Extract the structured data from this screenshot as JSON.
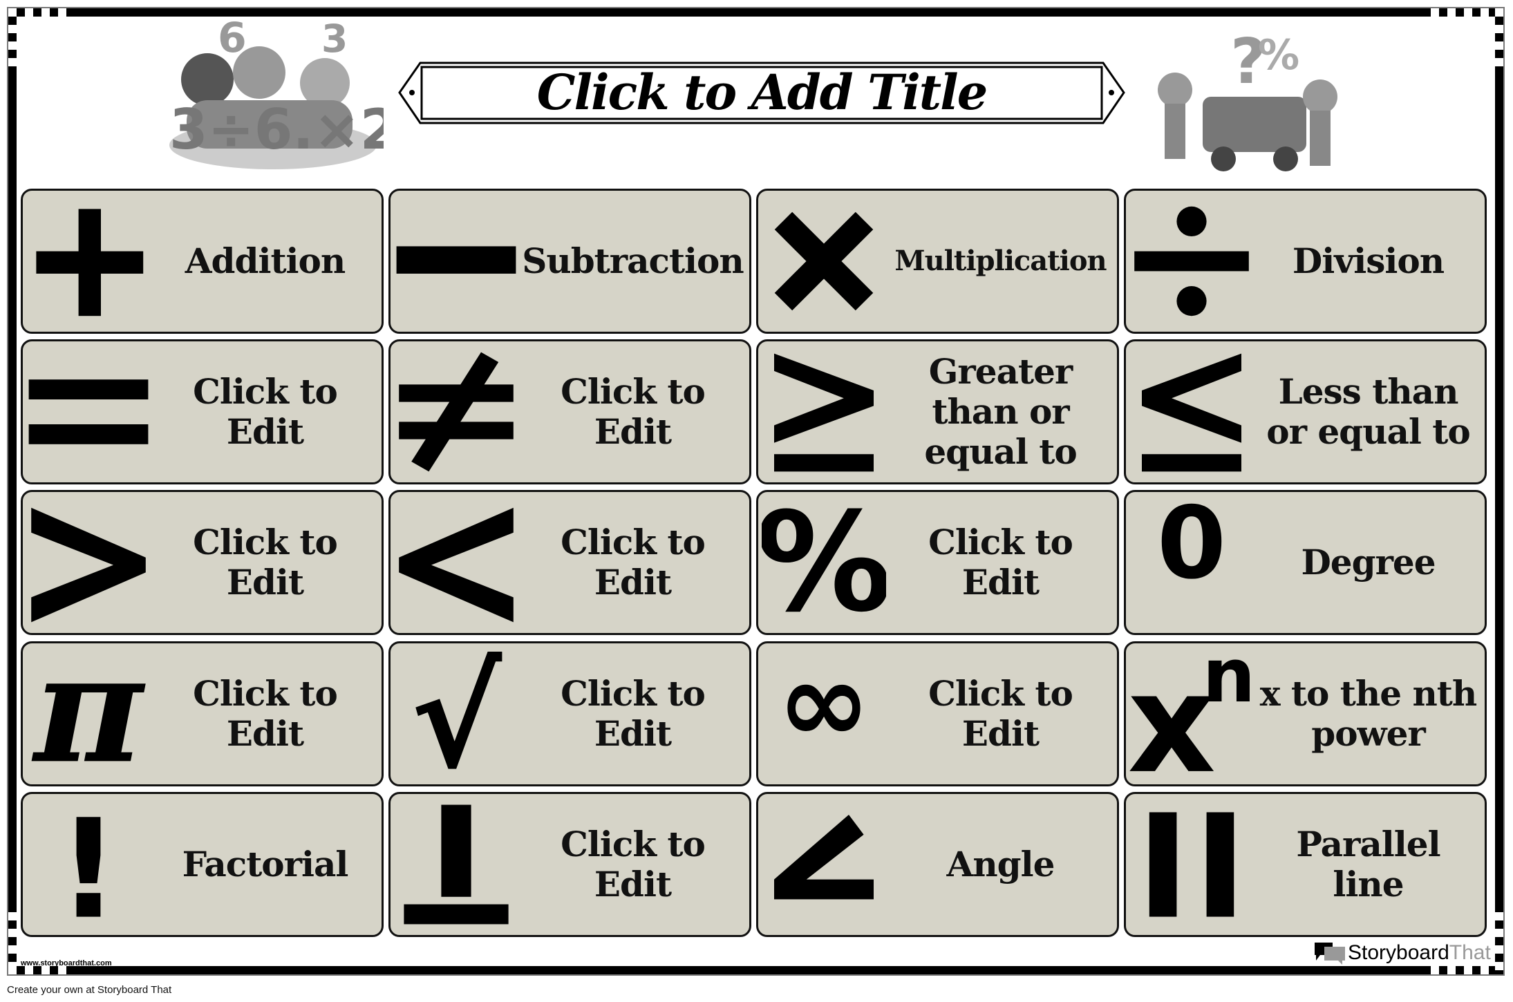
{
  "title": "Click to Add Title",
  "colors": {
    "card_bg": "#d6d4c8",
    "border": "#000000",
    "brand_gray": "#999999"
  },
  "cards": [
    {
      "symbol": "plus-icon",
      "label": "Addition"
    },
    {
      "symbol": "minus-icon",
      "label": "Subtraction"
    },
    {
      "symbol": "times-icon",
      "label": "Multiplication",
      "small": true
    },
    {
      "symbol": "divide-icon",
      "label": "Division"
    },
    {
      "symbol": "equals-icon",
      "label": "Click to Edit"
    },
    {
      "symbol": "not-equal-icon",
      "label": "Click to Edit"
    },
    {
      "symbol": "greater-equal-icon",
      "label": "Greater than or equal to"
    },
    {
      "symbol": "less-equal-icon",
      "label": "Less than or equal to"
    },
    {
      "symbol": "greater-than-icon",
      "label": "Click to Edit"
    },
    {
      "symbol": "less-than-icon",
      "label": "Click to Edit"
    },
    {
      "symbol": "percent-icon",
      "label": "Click to Edit"
    },
    {
      "symbol": "degree-icon",
      "label": "Degree"
    },
    {
      "symbol": "pi-icon",
      "label": "Click to Edit"
    },
    {
      "symbol": "square-root-icon",
      "label": "Click to Edit"
    },
    {
      "symbol": "infinity-icon",
      "label": "Click to Edit"
    },
    {
      "symbol": "exponent-icon",
      "label": "x to the nth power"
    },
    {
      "symbol": "factorial-icon",
      "label": "Factorial"
    },
    {
      "symbol": "perpendicular-icon",
      "label": "Click to Edit"
    },
    {
      "symbol": "angle-icon",
      "label": "Angle"
    },
    {
      "symbol": "parallel-icon",
      "label": "Parallel line"
    }
  ],
  "footer": {
    "watermark": "www.storyboardthat.com",
    "brand_a": "Storyboard",
    "brand_b": "That",
    "credit": "Create your own at Storyboard That"
  }
}
